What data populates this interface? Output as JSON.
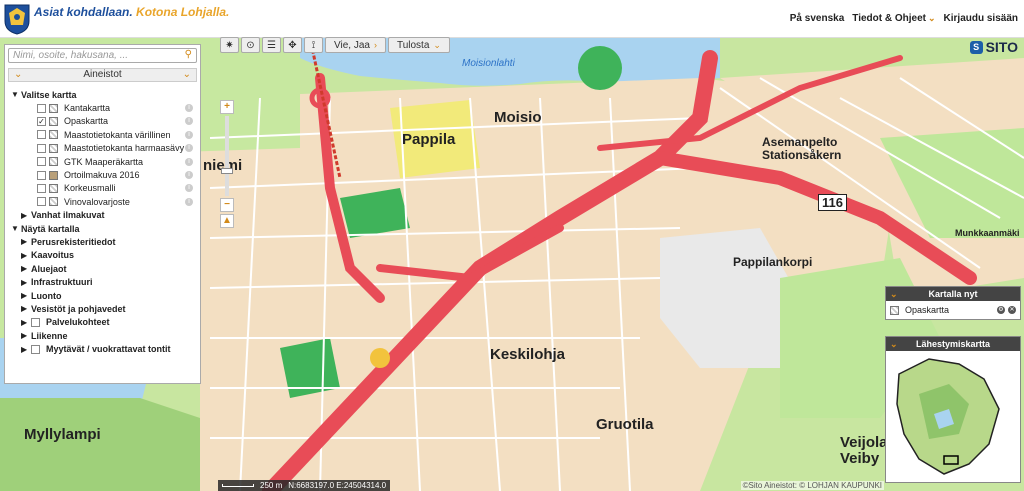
{
  "header": {
    "slogan_a": "Asiat kohdallaan.",
    "slogan_b": "Kotona Lohjalla.",
    "nav": [
      {
        "label": "På svenska",
        "chevron": false
      },
      {
        "label": "Tiedot & Ohjeet",
        "chevron": true
      },
      {
        "label": "Kirjaudu sisään",
        "chevron": false
      }
    ]
  },
  "toolbar": {
    "share_label": "Vie, Jaa",
    "print_label": "Tulosta",
    "brand": "SITO"
  },
  "panel": {
    "search_placeholder": "Nimi, osoite, hakusana, ...",
    "title": "Aineistot",
    "choose_map": "Valitse kartta",
    "basemaps": [
      {
        "label": "Kantakartta",
        "checked": false,
        "thumb": "pattern"
      },
      {
        "label": "Opaskartta",
        "checked": true,
        "thumb": "pattern"
      },
      {
        "label": "Maastotietokanta värillinen",
        "checked": false,
        "thumb": "pattern"
      },
      {
        "label": "Maastotietokanta harmaasävy",
        "checked": false,
        "thumb": "pattern"
      },
      {
        "label": "GTK Maaperäkartta",
        "checked": false,
        "thumb": "pattern"
      },
      {
        "label": "Ortoilmakuva 2016",
        "checked": false,
        "thumb": "photo"
      },
      {
        "label": "Korkeusmalli",
        "checked": false,
        "thumb": "pattern"
      },
      {
        "label": "Vinovalovarjoste",
        "checked": false,
        "thumb": "pattern"
      }
    ],
    "old_aerials": "Vanhat ilmakuvat",
    "show_on_map": "Näytä kartalla",
    "layers": [
      {
        "label": "Perusrekisteritiedot",
        "checkbox": false
      },
      {
        "label": "Kaavoitus",
        "checkbox": false
      },
      {
        "label": "Aluejaot",
        "checkbox": false
      },
      {
        "label": "Infrastruktuuri",
        "checkbox": false
      },
      {
        "label": "Luonto",
        "checkbox": false
      },
      {
        "label": "Vesistöt ja pohjavedet",
        "checkbox": false
      },
      {
        "label": "Palvelukohteet",
        "checkbox": true
      },
      {
        "label": "Liikenne",
        "checkbox": false
      },
      {
        "label": "Myytävät / vuokrattavat tontit",
        "checkbox": true
      }
    ]
  },
  "widgets": {
    "on_map_title": "Kartalla nyt",
    "on_map_item": "Opaskartta",
    "overview_title": "Lähestymiskartta"
  },
  "map_labels": {
    "pappila": "Pappila",
    "moisio": "Moisio",
    "asemanpelto": "Asemanpelto",
    "stationsakern": "Stationsåkern",
    "pappilankorpi": "Pappilankorpi",
    "keskilohja": "Keskilohja",
    "gruotila": "Gruotila",
    "myllylampi": "Myllylampi",
    "veijola": "Veijola",
    "veiby": "Veiby",
    "niemi": "niemi",
    "moisionlahti": "Moisionlahti",
    "munkkaanmaki": "Munkkaanmäki",
    "road_number": "116"
  },
  "footer": {
    "scale_label": "250 m",
    "coords": "N:6683197.0 E:24504314.0",
    "attribution": "©Sito Aineistot: © LOHJAN KAUPUNKI"
  },
  "colors": {
    "brand_blue": "#1d4f9c",
    "brand_gold": "#e9a52b",
    "road_red": "#e84c57",
    "water_blue": "#a9d3f0",
    "green_area": "#3fb35a",
    "urban": "#f3dfc2"
  }
}
